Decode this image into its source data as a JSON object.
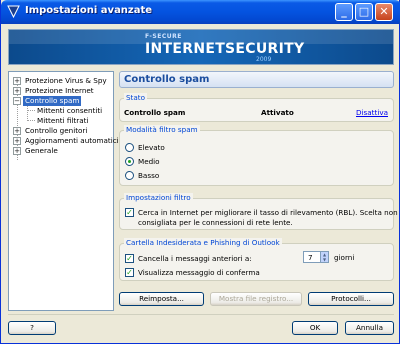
{
  "window": {
    "title": "Impostazioni avanzate",
    "minimize": "_",
    "maximize": "□",
    "close": "✕"
  },
  "banner": {
    "brand_small": "F-SECURE",
    "brand_main": "INTERNETSECURITY",
    "brand_year": "2009"
  },
  "tree": {
    "items": [
      {
        "label": "Protezione Virus & Spy",
        "expander": "+"
      },
      {
        "label": "Protezione Internet",
        "expander": "+"
      },
      {
        "label": "Controllo spam",
        "expander": "−"
      },
      {
        "label": "Mittenti consentiti"
      },
      {
        "label": "Mittenti filtrati"
      },
      {
        "label": "Controllo genitori",
        "expander": "+"
      },
      {
        "label": "Aggiornamenti automatici",
        "expander": "+"
      },
      {
        "label": "Generale",
        "expander": "+"
      }
    ]
  },
  "pane": {
    "title": "Controllo spam"
  },
  "status": {
    "group": "Stato",
    "name": "Controllo spam",
    "state": "Attivato",
    "action": "Disattiva"
  },
  "mode": {
    "group": "Modalità filtro spam",
    "options": [
      "Elevato",
      "Medio",
      "Basso"
    ],
    "selected": "Medio"
  },
  "filter": {
    "group": "Impostazioni filtro",
    "option_line1": "Cerca in Internet per migliorare il tasso di rilevamento (RBL). Scelta non",
    "option_line2": "consigliata per le connessioni di rete lente.",
    "checked": true
  },
  "outlook": {
    "group": "Cartella Indesiderata e Phishing di Outlook",
    "delete_label": "Cancella i messaggi anteriori a:",
    "days_value": "7",
    "days_unit": "giorni",
    "confirm_label": "Visualizza messaggio di conferma",
    "delete_checked": true,
    "confirm_checked": true
  },
  "buttons": {
    "reset": "Reimposta...",
    "show_log": "Mostra file registro...",
    "protocols": "Protocolli...",
    "help": "?",
    "ok": "OK",
    "cancel": "Annulla"
  }
}
